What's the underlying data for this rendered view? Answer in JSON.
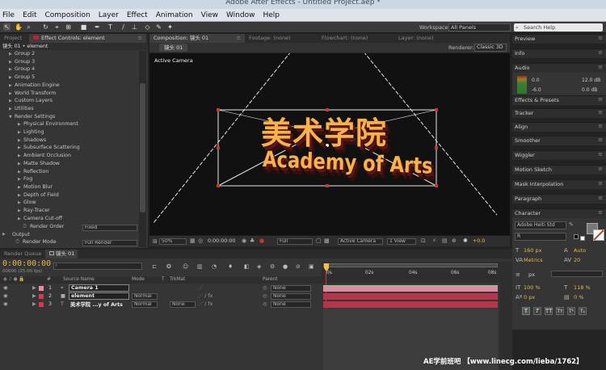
{
  "window_title": "Adobe After Effects - Untitled Project.aep *",
  "menu": [
    "File",
    "Edit",
    "Composition",
    "Layer",
    "Effect",
    "Animation",
    "View",
    "Window",
    "Help"
  ],
  "workspace": {
    "label": "Workspace:",
    "value": "All Panels",
    "search_placeholder": "Search Help"
  },
  "left_tabs": {
    "project": "Project",
    "effect_controls": "Effect Controls: element"
  },
  "effect_controls": {
    "header": "镜头 01 • element",
    "items": [
      {
        "label": "Group 2",
        "indent": 1
      },
      {
        "label": "Group 3",
        "indent": 1
      },
      {
        "label": "Group 4",
        "indent": 1
      },
      {
        "label": "Group 5",
        "indent": 1
      },
      {
        "label": "Animation Engine",
        "indent": 1
      },
      {
        "label": "World Transform",
        "indent": 1
      },
      {
        "label": "Custom Layers",
        "indent": 1
      },
      {
        "label": "Utilities",
        "indent": 1
      },
      {
        "label": "Render Settings",
        "indent": 1,
        "open": true
      },
      {
        "label": "Physical Environment",
        "indent": 2
      },
      {
        "label": "Lighting",
        "indent": 2
      },
      {
        "label": "Shadows",
        "indent": 2
      },
      {
        "label": "Subsurface Scattering",
        "indent": 2
      },
      {
        "label": "Ambient Occlusion",
        "indent": 2
      },
      {
        "label": "Matte Shadow",
        "indent": 2
      },
      {
        "label": "Reflection",
        "indent": 2
      },
      {
        "label": "Fog",
        "indent": 2
      },
      {
        "label": "Motion Blur",
        "indent": 2
      },
      {
        "label": "Depth of Field",
        "indent": 2
      },
      {
        "label": "Glow",
        "indent": 2
      },
      {
        "label": "Ray-Tracer",
        "indent": 2
      },
      {
        "label": "Camera Cut-off",
        "indent": 2
      }
    ],
    "render_order": {
      "label": "Render Order",
      "value": "Fixed"
    },
    "output": "Output",
    "render_mode": {
      "label": "Render Mode",
      "value": "Full Render"
    }
  },
  "comp_tabs": {
    "composition": "Composition: 镜头 01",
    "footage": "Footage: (none)",
    "flowchart": "Flowchart: (none)",
    "layer": "Layer: (none)"
  },
  "comp_subtab": "镜头 01",
  "renderer": {
    "label": "Renderer:",
    "value": "Classic 3D"
  },
  "viewer": {
    "camera_label": "Active Camera",
    "title_cn": "美术学院",
    "title_en": "Academy of Arts"
  },
  "viewer_bar": {
    "zoom": "50%",
    "timecode": "0:00:00:00",
    "resolution": "Full",
    "view": "Active Camera",
    "views": "1 View",
    "exposure": "+0.0"
  },
  "right_panels": [
    "Preview",
    "Info",
    "Audio",
    "Effects & Presets",
    "Tracker",
    "Align",
    "Smoother",
    "Wiggler",
    "Motion Sketch",
    "Mask Interpolation",
    "Paragraph",
    "Character"
  ],
  "audio": {
    "val1": "0.0",
    "val2": "-6.0",
    "db1": "12.0 dB",
    "db2": "0.0 dB"
  },
  "character": {
    "font": "Adobe Heiti Std",
    "style": "R",
    "size": "160 px",
    "leading": "Auto",
    "kerning": "Metrics",
    "tracking": "20",
    "stroke": "px",
    "vscale": "118 %",
    "hscale": "100 %",
    "baseline": "0 px",
    "tsume": "0 %",
    "colors": {
      "fill": "#ffffff",
      "stroke": "#c0392b"
    }
  },
  "timeline": {
    "tabs": {
      "render_queue": "Render Queue",
      "comp": "镜头 01"
    },
    "timecode": "0:00:00:00",
    "frames": "00000 (25.00 fps)",
    "columns": {
      "num": "#",
      "source": "Source Name",
      "mode": "Mode",
      "t": "T",
      "trkmat": "TrkMat",
      "parent": "Parent"
    },
    "ruler": [
      "0s",
      "02s",
      "04s",
      "06s",
      "08s"
    ],
    "layers": [
      {
        "num": "1",
        "name": "Camera 1",
        "label_color": "#e58fa1",
        "mode": "",
        "trkmat": "",
        "parent": "None"
      },
      {
        "num": "2",
        "name": "element",
        "label_color": "#d7364f",
        "mode": "Normal",
        "trkmat": "",
        "parent": "None"
      },
      {
        "num": "3",
        "name": "美术学院 ...y of Arts",
        "label_color": "#d7364f",
        "mode": "Normal",
        "trkmat": "None",
        "parent": "None"
      }
    ]
  },
  "watermark": "AE学前班吧 【www.linecg.com/lieba/1762】"
}
